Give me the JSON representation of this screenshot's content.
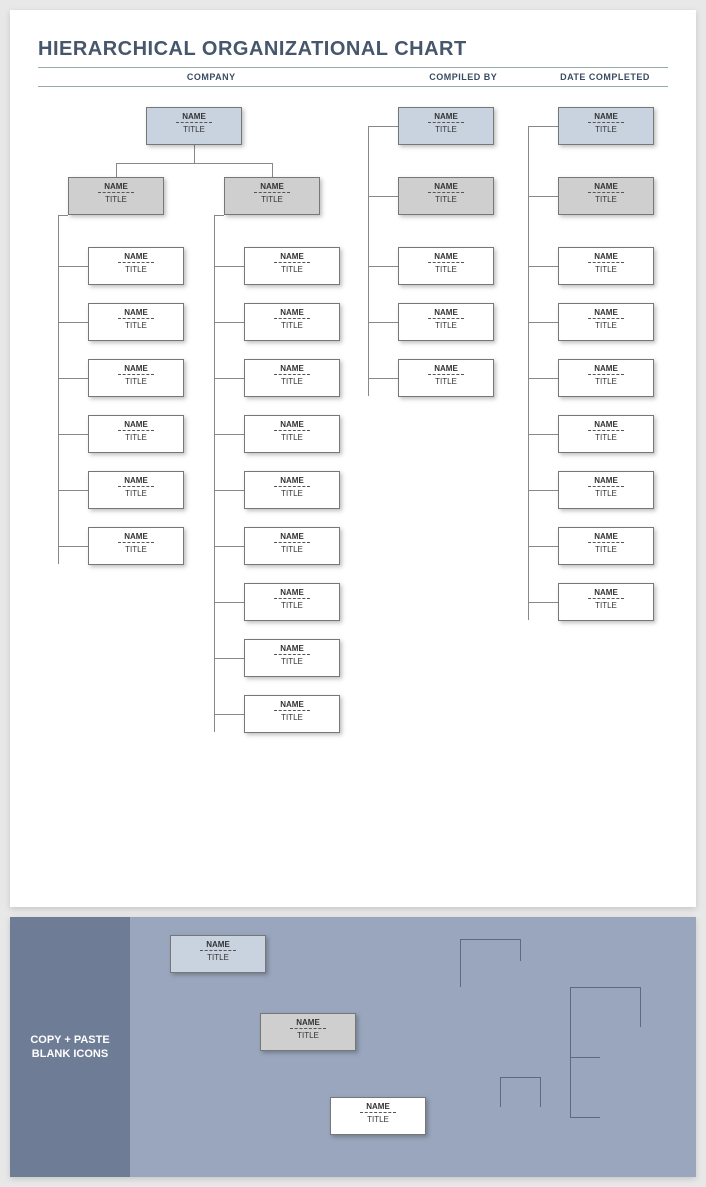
{
  "title": "HIERARCHICAL ORGANIZATIONAL CHART",
  "header": {
    "company": "COMPANY",
    "compiled_by": "COMPILED BY",
    "date_completed": "DATE COMPLETED"
  },
  "node_labels": {
    "name": "NAME",
    "title": "TITLE"
  },
  "sidebar_label": "COPY + PASTE BLANK ICONS",
  "chart_data": {
    "type": "org-chart",
    "branches": [
      {
        "id": "branch-a",
        "top": {
          "name": "NAME",
          "title": "TITLE",
          "style": "blue"
        },
        "managers": [
          {
            "name": "NAME",
            "title": "TITLE",
            "style": "grey",
            "reports": [
              {
                "name": "NAME",
                "title": "TITLE"
              },
              {
                "name": "NAME",
                "title": "TITLE"
              },
              {
                "name": "NAME",
                "title": "TITLE"
              },
              {
                "name": "NAME",
                "title": "TITLE"
              },
              {
                "name": "NAME",
                "title": "TITLE"
              },
              {
                "name": "NAME",
                "title": "TITLE"
              }
            ]
          },
          {
            "name": "NAME",
            "title": "TITLE",
            "style": "grey",
            "reports": [
              {
                "name": "NAME",
                "title": "TITLE"
              },
              {
                "name": "NAME",
                "title": "TITLE"
              },
              {
                "name": "NAME",
                "title": "TITLE"
              },
              {
                "name": "NAME",
                "title": "TITLE"
              },
              {
                "name": "NAME",
                "title": "TITLE"
              },
              {
                "name": "NAME",
                "title": "TITLE"
              },
              {
                "name": "NAME",
                "title": "TITLE"
              },
              {
                "name": "NAME",
                "title": "TITLE"
              },
              {
                "name": "NAME",
                "title": "TITLE"
              }
            ]
          }
        ]
      },
      {
        "id": "branch-b",
        "top": {
          "name": "NAME",
          "title": "TITLE",
          "style": "blue"
        },
        "managers": [
          {
            "name": "NAME",
            "title": "TITLE",
            "style": "grey",
            "reports": [
              {
                "name": "NAME",
                "title": "TITLE"
              },
              {
                "name": "NAME",
                "title": "TITLE"
              },
              {
                "name": "NAME",
                "title": "TITLE"
              }
            ]
          }
        ]
      },
      {
        "id": "branch-c",
        "top": {
          "name": "NAME",
          "title": "TITLE",
          "style": "blue"
        },
        "managers": [
          {
            "name": "NAME",
            "title": "TITLE",
            "style": "grey",
            "reports": [
              {
                "name": "NAME",
                "title": "TITLE"
              },
              {
                "name": "NAME",
                "title": "TITLE"
              },
              {
                "name": "NAME",
                "title": "TITLE"
              },
              {
                "name": "NAME",
                "title": "TITLE"
              },
              {
                "name": "NAME",
                "title": "TITLE"
              },
              {
                "name": "NAME",
                "title": "TITLE"
              },
              {
                "name": "NAME",
                "title": "TITLE"
              }
            ]
          }
        ]
      }
    ],
    "palette_nodes": [
      {
        "name": "NAME",
        "title": "TITLE",
        "style": "blue"
      },
      {
        "name": "NAME",
        "title": "TITLE",
        "style": "grey"
      },
      {
        "name": "NAME",
        "title": "TITLE",
        "style": "white"
      }
    ]
  }
}
